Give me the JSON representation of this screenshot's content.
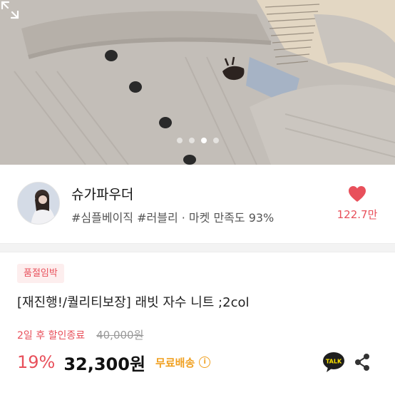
{
  "hero": {
    "slide_count": 4,
    "active_slide": 3
  },
  "seller": {
    "name": "슈가파우더",
    "tags": "#심플베이직 #러블리 · 마켓 만족도 93%",
    "likes": "122.7만",
    "avatar_text": "SUGAR POWDER"
  },
  "product": {
    "badge": "품절임박",
    "title": "[재진행!/퀄리티보장] 래빗 자수 니트 ;2col",
    "sale_timer": "2일 후 할인종료",
    "original_price": "40,000원",
    "discount": "19%",
    "price": "32,300원",
    "shipping": "무료배송",
    "info_icon": "i"
  },
  "actions": {
    "talk_label": "TALK"
  },
  "colors": {
    "accent": "#e8505b",
    "shipping": "#f0a020",
    "talk_yellow": "#fae100"
  },
  "icons": [
    "expand-icon",
    "heart-icon",
    "info-icon",
    "kakao-talk-icon",
    "share-icon"
  ]
}
